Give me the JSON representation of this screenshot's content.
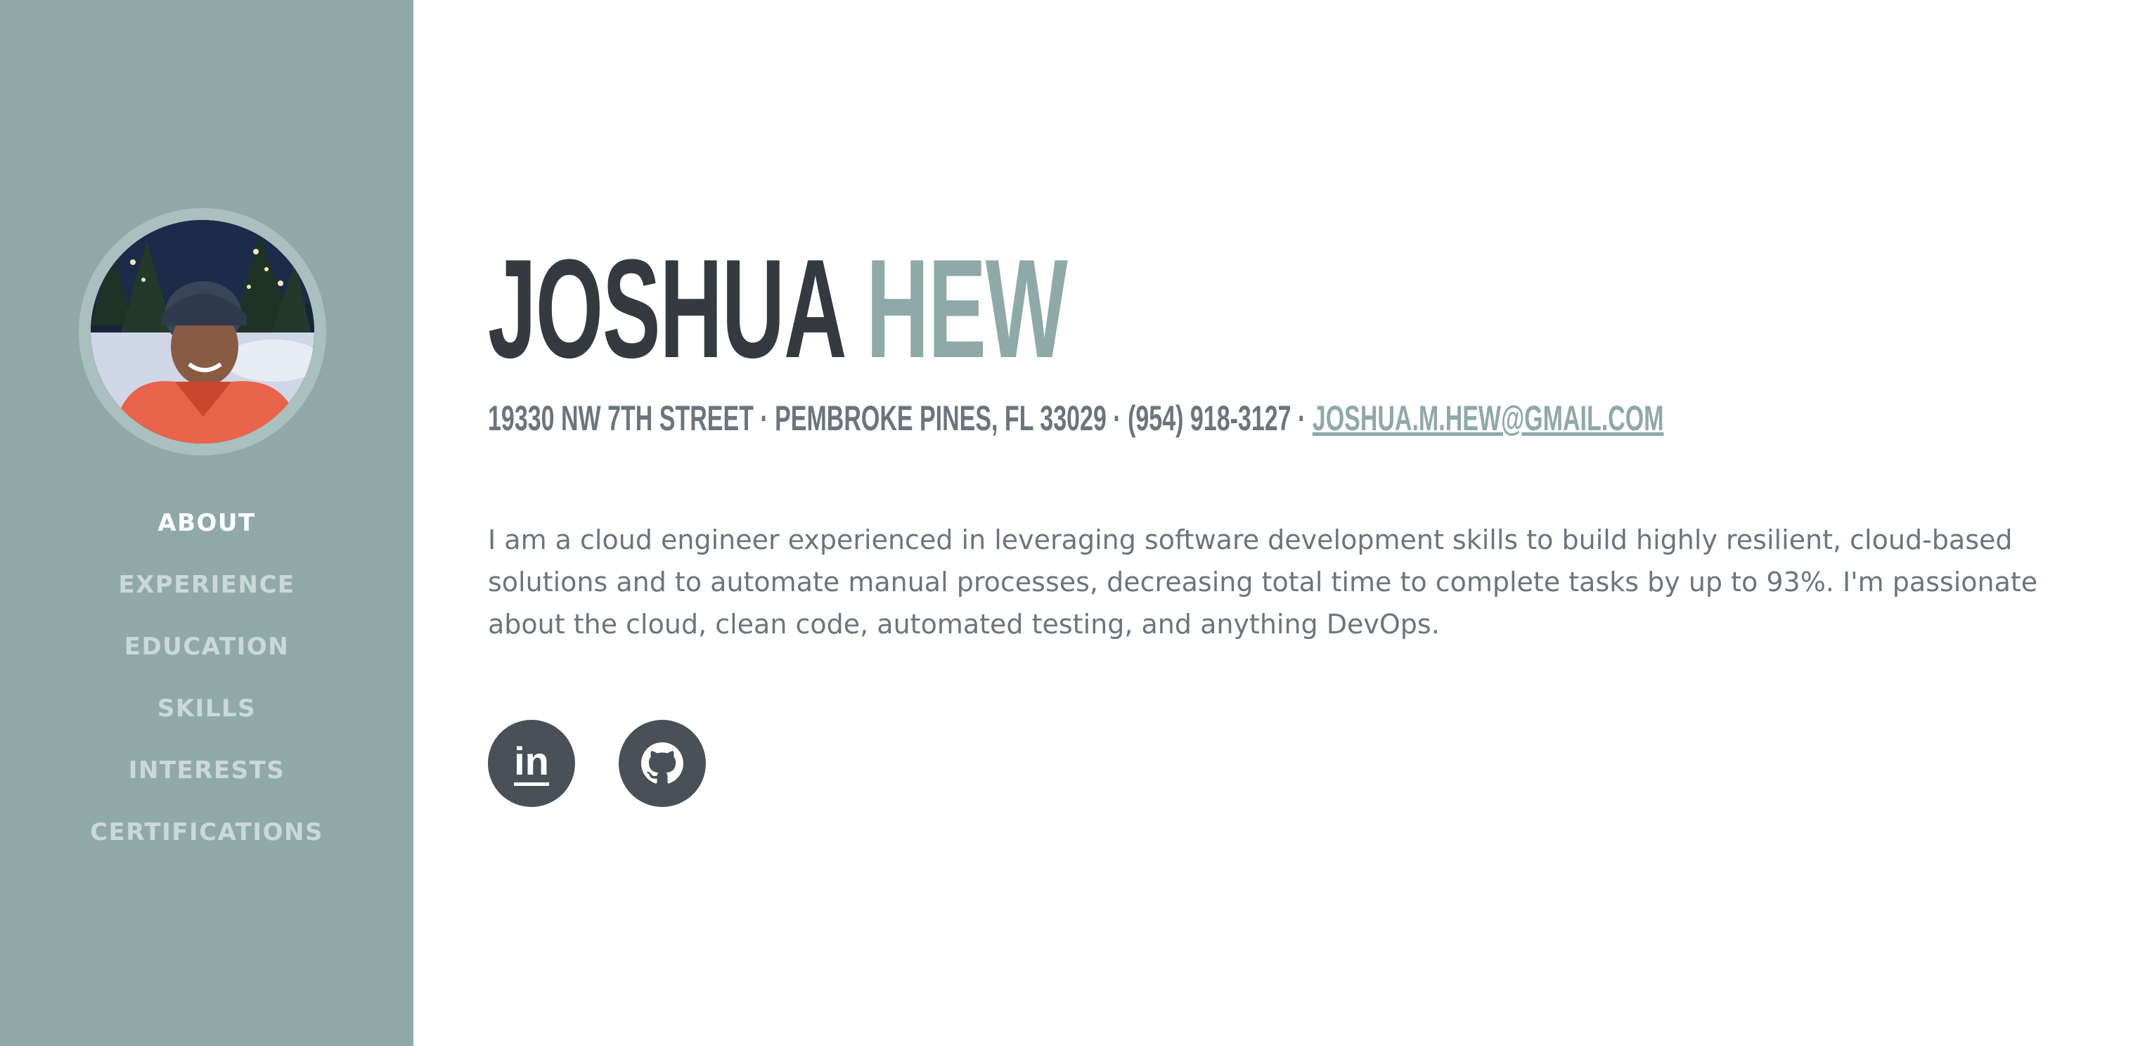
{
  "sidebar": {
    "avatar_alt": "Profile photo",
    "nav": [
      {
        "label": "About",
        "active": true
      },
      {
        "label": "Experience",
        "active": false
      },
      {
        "label": "Education",
        "active": false
      },
      {
        "label": "Skills",
        "active": false
      },
      {
        "label": "Interests",
        "active": false
      },
      {
        "label": "Certifications",
        "active": false
      }
    ]
  },
  "about": {
    "first_name": "JOSHUA",
    "last_name": "HEW",
    "address": "19330 NW 7th Street · Pembroke Pines, FL 33029 · (954) 918-3127 · ",
    "email": "joshua.m.hew@gmail.com",
    "bio": "I am a cloud engineer experienced in leveraging software development skills to build highly resilient, cloud-based solutions and to automate manual processes, decreasing total time to complete tasks by up to 93%. I'm passionate about the cloud, clean code, automated testing, and anything DevOps.",
    "social": [
      {
        "icon": "linkedin-icon",
        "glyph": "in"
      },
      {
        "icon": "github-icon",
        "glyph": ""
      }
    ]
  },
  "colors": {
    "sidebar_bg": "#8fa9a8",
    "accent": "#8fa9a8",
    "heading": "#343a40",
    "text": "#6c757d",
    "social_bg": "#495057"
  }
}
